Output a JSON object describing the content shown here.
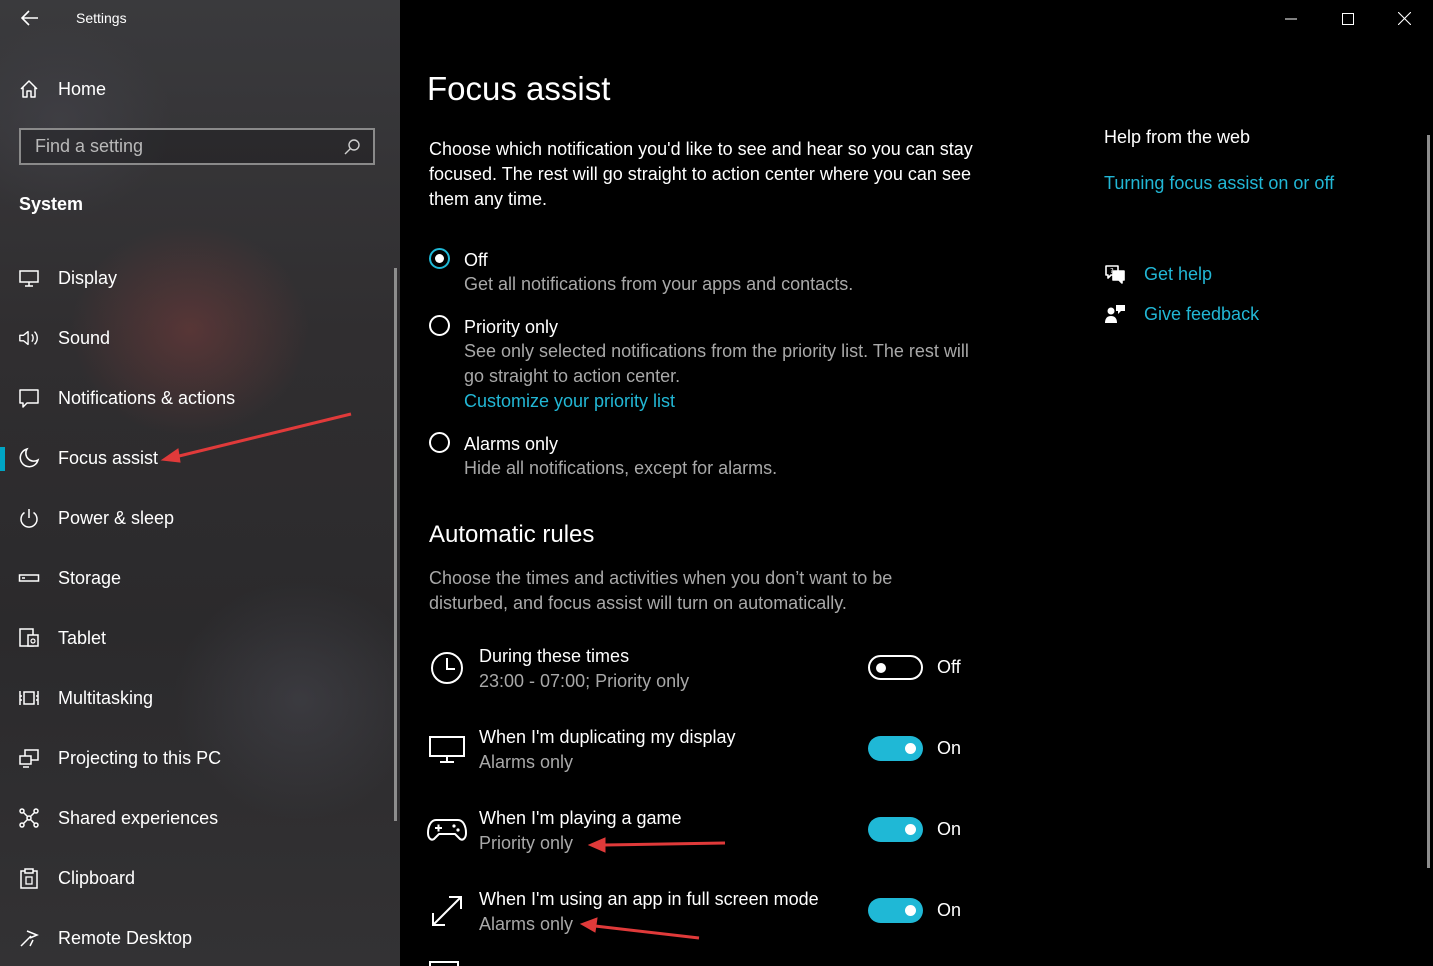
{
  "window": {
    "title": "Settings",
    "controls": {
      "minimize": "minimize-icon",
      "maximize": "maximize-icon",
      "close": "close-icon"
    }
  },
  "sidebar": {
    "home_label": "Home",
    "search_placeholder": "Find a setting",
    "section_title": "System",
    "items": [
      {
        "label": "Display",
        "icon": "display-icon"
      },
      {
        "label": "Sound",
        "icon": "speaker-icon"
      },
      {
        "label": "Notifications & actions",
        "icon": "notification-icon"
      },
      {
        "label": "Focus assist",
        "icon": "moon-icon",
        "selected": true
      },
      {
        "label": "Power & sleep",
        "icon": "power-icon"
      },
      {
        "label": "Storage",
        "icon": "storage-icon"
      },
      {
        "label": "Tablet",
        "icon": "tablet-icon"
      },
      {
        "label": "Multitasking",
        "icon": "multitasking-icon"
      },
      {
        "label": "Projecting to this PC",
        "icon": "projecting-icon"
      },
      {
        "label": "Shared experiences",
        "icon": "shared-icon"
      },
      {
        "label": "Clipboard",
        "icon": "clipboard-icon"
      },
      {
        "label": "Remote Desktop",
        "icon": "remote-icon"
      }
    ]
  },
  "main": {
    "title": "Focus assist",
    "intro": "Choose which notification you'd like to see and hear so you can stay focused. The rest will go straight to action center where you can see them any time.",
    "options": [
      {
        "label": "Off",
        "description": "Get all notifications from your apps and contacts.",
        "selected": true
      },
      {
        "label": "Priority only",
        "description": "See only selected notifications from the priority list. The rest will go straight to action center.",
        "link": "Customize your priority list"
      },
      {
        "label": "Alarms only",
        "description": "Hide all notifications, except for alarms."
      }
    ],
    "automatic_rules": {
      "title": "Automatic rules",
      "description": "Choose the times and activities when you don’t want to be disturbed, and focus assist will turn on automatically.",
      "rules": [
        {
          "title": "During these times",
          "subtitle": "23:00 - 07:00; Priority only",
          "state": "Off",
          "icon": "clock-icon"
        },
        {
          "title": "When I'm duplicating my display",
          "subtitle": "Alarms only",
          "state": "On",
          "icon": "monitor-icon"
        },
        {
          "title": "When I'm playing a game",
          "subtitle": "Priority only",
          "state": "On",
          "icon": "gamepad-icon"
        },
        {
          "title": "When I'm using an app in full screen mode",
          "subtitle": "Alarms only",
          "state": "On",
          "icon": "fullscreen-icon"
        }
      ]
    }
  },
  "help": {
    "title": "Help from the web",
    "link": "Turning focus assist on or off",
    "get_help": "Get help",
    "give_feedback": "Give feedback"
  },
  "colors": {
    "accent": "#1fb8d6",
    "link": "#22b7d5",
    "annotation_arrow": "#e03a3a",
    "secondary_text": "#a8a8a8"
  }
}
